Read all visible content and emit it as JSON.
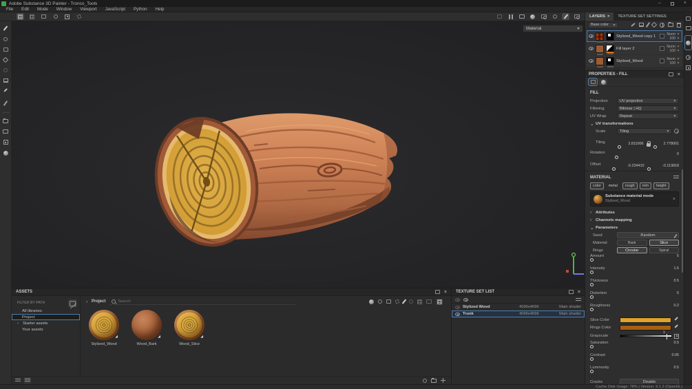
{
  "icons": {
    "close": "×",
    "minimize": "–",
    "expander_right": "›",
    "expander_down": "⌄"
  },
  "titlebar": {
    "title": "Adobe Substance 3D Painter - Tronco_Tools"
  },
  "menubar": {
    "items": [
      "File",
      "Edit",
      "Mode",
      "Window",
      "Viewport",
      "JavaScript",
      "Python",
      "Help"
    ]
  },
  "viewport": {
    "shading_mode": "Material"
  },
  "layers_panel": {
    "tabs": [
      {
        "label": "LAYERS"
      },
      {
        "label": "TEXTURE SET SETTINGS"
      }
    ],
    "channel_filter": "Base color",
    "layers": [
      {
        "name": "Stylized_Wood copy 1",
        "blend": "Norm",
        "opacity": "100"
      },
      {
        "name": "Fill layer 2",
        "blend": "Norm",
        "opacity": "100"
      },
      {
        "name": "Stylized_Wood",
        "blend": "Norm",
        "opacity": "100"
      }
    ]
  },
  "properties_panel": {
    "title": "PROPERTIES - FILL",
    "fill": {
      "heading": "FILL",
      "projection_label": "Projection",
      "projection_value": "UV projection",
      "filtering_label": "Filtering",
      "filtering_value": "Bilinear | HQ",
      "uv_wrap_label": "UV Wrap",
      "uv_wrap_value": "Repeat",
      "uv_transformations_heading": "UV transformations",
      "scale_label": "Scale",
      "scale_value": "Tiling",
      "tiling_label": "Tiling",
      "tiling_x": "2.811006",
      "tiling_y": "2.778001",
      "rotation_label": "Rotation",
      "rotation_value": "0",
      "offset_label": "Offset",
      "offset_x": "-0.234410",
      "offset_y": "-0.113818"
    },
    "material": {
      "heading": "MATERIAL",
      "channels": [
        {
          "label": "color"
        },
        {
          "label": "metal"
        },
        {
          "label": "rough"
        },
        {
          "label": "nrm"
        },
        {
          "label": "height"
        }
      ],
      "mode_title": "Substance material mode",
      "mode_subtitle": "Stylized_Wood",
      "attributes_heading": "Attributes",
      "channels_mapping_heading": "Channels mapping",
      "parameters_heading": "Parameters",
      "seed_label": "Seed",
      "seed_value": "Random",
      "material_label": "Material",
      "material_options": [
        {
          "label": "Bark"
        },
        {
          "label": "Slice"
        }
      ],
      "rings_label": "Rings",
      "rings_options": [
        {
          "label": "Circular"
        },
        {
          "label": "Spiral"
        }
      ],
      "sliders": [
        {
          "label": "Amount",
          "value": "5"
        },
        {
          "label": "Intensity",
          "value": "1.5"
        },
        {
          "label": "Thickness",
          "value": "0.5"
        },
        {
          "label": "Distortion",
          "value": "5"
        },
        {
          "label": "Roughness",
          "value": "0.2"
        }
      ],
      "slice_color_label": "Slice Color",
      "slice_color": "#dia",
      "slice_color_hex": "#dda32b",
      "rings_color_label": "Rings Color",
      "rings_color_hex": "#a85f10",
      "grayscale_label": "Grayscale",
      "grayscale_value": "1",
      "sliders2": [
        {
          "label": "Saturation",
          "value": "0.5"
        },
        {
          "label": "Contrast",
          "value": "0.05"
        },
        {
          "label": "Luminosity",
          "value": "0.5"
        }
      ],
      "cracks_label": "Cracks",
      "cracks_value": "Disable"
    }
  },
  "assets_panel": {
    "title": "ASSETS",
    "filter_label": "FILTER BY PATH",
    "tree": [
      {
        "label": "All libraries"
      },
      {
        "label": "Project"
      },
      {
        "label": "Starter assets"
      },
      {
        "label": "Your assets"
      }
    ],
    "breadcrumb": "Project",
    "search_placeholder": "Search",
    "assets": [
      {
        "name": "Stylized_Wood"
      },
      {
        "name": "Wood_Bark"
      },
      {
        "name": "Wood_Slice"
      }
    ]
  },
  "texture_set_list": {
    "title": "TEXTURE SET LIST",
    "rows": [
      {
        "name": "Stylized Wood",
        "resolution": "4096x4096",
        "shader": "Main shader"
      },
      {
        "name": "Trunk",
        "resolution": "4096x4096",
        "shader": "Main shader"
      }
    ]
  },
  "statusbar": {
    "text": "Cache Disk Usage:   78% | Version: 9.1.2 (OpenGL)"
  }
}
